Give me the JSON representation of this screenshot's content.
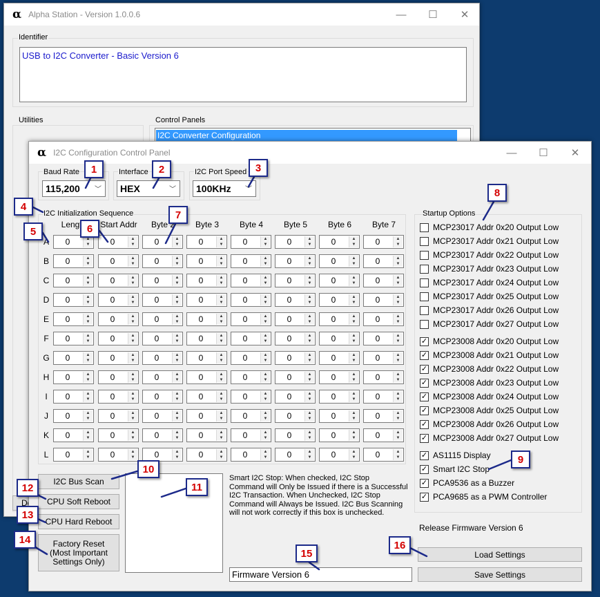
{
  "main_window": {
    "title": "Alpha Station - Version 1.0.0.6",
    "logo": "α",
    "identifier_label": "Identifier",
    "identifier_value": "USB to I2C Converter - Basic Version 6",
    "utilities_label": "Utilities",
    "control_panels_label": "Control Panels",
    "control_panel_item": "I2C Converter Configuration",
    "behind_button_partial": "Do"
  },
  "dialog": {
    "title": "I2C Configuration Control Panel",
    "logo": "α",
    "baud_rate": {
      "label": "Baud Rate",
      "value": "115,200"
    },
    "interface": {
      "label": "Interface",
      "value": "HEX"
    },
    "port_speed": {
      "label": "I2C Port Speed",
      "value": "100KHz"
    },
    "init_seq_label": "I2C Initialization Sequence",
    "columns": [
      "Length",
      "Start Addr",
      "Byte 2",
      "Byte 3",
      "Byte 4",
      "Byte 5",
      "Byte 6",
      "Byte 7"
    ],
    "rows": [
      "A",
      "B",
      "C",
      "D",
      "E",
      "F",
      "G",
      "H",
      "I",
      "J",
      "K",
      "L"
    ],
    "cell_value": "0",
    "startup_label": "Startup Options",
    "options": [
      {
        "label": "MCP23017  Addr 0x20 Output Low",
        "checked": false
      },
      {
        "label": "MCP23017  Addr 0x21 Output Low",
        "checked": false
      },
      {
        "label": "MCP23017  Addr 0x22 Output Low",
        "checked": false
      },
      {
        "label": "MCP23017  Addr 0x23 Output Low",
        "checked": false
      },
      {
        "label": "MCP23017  Addr 0x24 Output Low",
        "checked": false
      },
      {
        "label": "MCP23017  Addr 0x25 Output Low",
        "checked": false
      },
      {
        "label": "MCP23017  Addr 0x26 Output Low",
        "checked": false
      },
      {
        "label": "MCP23017  Addr 0x27 Output Low",
        "checked": false
      },
      {
        "label": "MCP23008  Addr 0x20 Output Low",
        "checked": true
      },
      {
        "label": "MCP23008  Addr 0x21 Output Low",
        "checked": true
      },
      {
        "label": "MCP23008  Addr 0x22 Output Low",
        "checked": true
      },
      {
        "label": "MCP23008  Addr 0x23 Output Low",
        "checked": true
      },
      {
        "label": "MCP23008  Addr 0x24 Output Low",
        "checked": true
      },
      {
        "label": "MCP23008  Addr 0x25 Output Low",
        "checked": true
      },
      {
        "label": "MCP23008  Addr 0x26 Output Low",
        "checked": true
      },
      {
        "label": "MCP23008  Addr 0x27 Output Low",
        "checked": true
      },
      {
        "label": "AS1115 Display",
        "checked": true
      },
      {
        "label": "Smart I2C Stop",
        "checked": true
      },
      {
        "label": "PCA9536 as a Buzzer",
        "checked": true
      },
      {
        "label": "PCA9685 as a PWM Controller",
        "checked": true
      }
    ],
    "buttons": {
      "bus_scan": "I2C Bus Scan",
      "soft_reboot": "CPU Soft Reboot",
      "hard_reboot": "CPU Hard Reboot",
      "factory_reset": "Factory Reset\n(Most Important\nSettings Only)",
      "load": "Load Settings",
      "save": "Save Settings"
    },
    "smart_stop_note": "Smart I2C Stop: When checked, I2C Stop\nCommand will Only be Issued if there is a Successful\nI2C Transaction.  When Unchecked, I2C Stop\nCommand will Always be Issued.  I2C Bus Scanning\nwill not work correctly if this box is unchecked.",
    "release_text": "Release Firmware Version 6",
    "firmware_field": "Firmware Version 6"
  },
  "badges": [
    "1",
    "2",
    "3",
    "4",
    "5",
    "6",
    "7",
    "8",
    "9",
    "10",
    "11",
    "12",
    "13",
    "14",
    "15",
    "16"
  ]
}
